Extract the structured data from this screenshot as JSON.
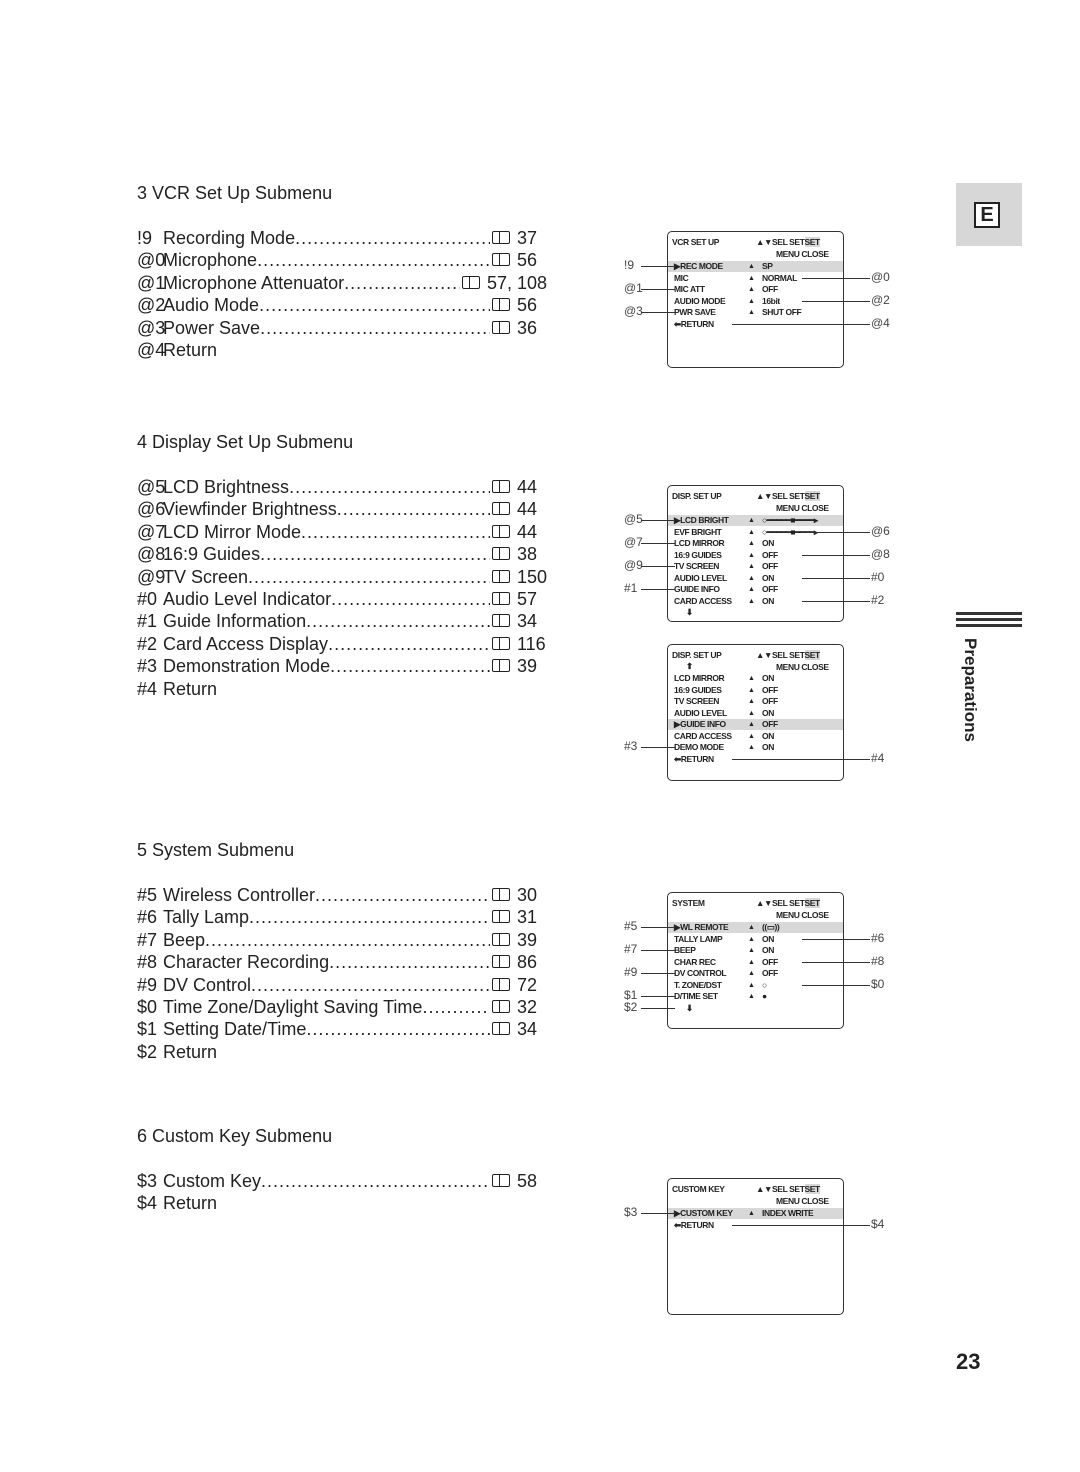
{
  "sections": [
    {
      "title": "3  VCR Set Up Submenu",
      "items": [
        {
          "code": "!9",
          "label": "Recording Mode",
          "page": "37"
        },
        {
          "code": "@0",
          "label": "Microphone",
          "page": "56"
        },
        {
          "code": "@1",
          "label": "Microphone Attenuator",
          "page": "57, 108"
        },
        {
          "code": "@2",
          "label": "Audio Mode",
          "page": "56"
        },
        {
          "code": "@3",
          "label": "Power Save",
          "page": "36"
        },
        {
          "code": "@4",
          "label": "Return",
          "page": ""
        }
      ]
    },
    {
      "title": "4  Display Set Up Submenu",
      "items": [
        {
          "code": "@5",
          "label": "LCD Brightness",
          "page": "44"
        },
        {
          "code": "@6",
          "label": "Viewfinder Brightness",
          "page": "44"
        },
        {
          "code": "@7",
          "label": "LCD Mirror Mode",
          "page": "44"
        },
        {
          "code": "@8",
          "label": "16:9 Guides",
          "page": "38"
        },
        {
          "code": "@9",
          "label": "TV Screen",
          "page": "150"
        },
        {
          "code": "#0",
          "label": "Audio Level Indicator",
          "page": "57"
        },
        {
          "code": "#1",
          "label": "Guide Information",
          "page": "34"
        },
        {
          "code": "#2",
          "label": "Card Access Display",
          "page": "116"
        },
        {
          "code": "#3",
          "label": "Demonstration Mode",
          "page": "39"
        },
        {
          "code": "#4",
          "label": "Return",
          "page": ""
        }
      ]
    },
    {
      "title": "5  System Submenu",
      "items": [
        {
          "code": "#5",
          "label": "Wireless Controller",
          "page": "30"
        },
        {
          "code": "#6",
          "label": "Tally Lamp",
          "page": "31"
        },
        {
          "code": "#7",
          "label": "Beep",
          "page": "39"
        },
        {
          "code": "#8",
          "label": "Character Recording",
          "page": "86"
        },
        {
          "code": "#9",
          "label": "DV Control",
          "page": "72"
        },
        {
          "code": "$0",
          "label": "Time Zone/Daylight Saving Time",
          "page": "32"
        },
        {
          "code": "$1",
          "label": "Setting Date/Time",
          "page": "34"
        },
        {
          "code": "$2",
          "label": "Return",
          "page": ""
        }
      ]
    },
    {
      "title": "6  Custom Key Submenu",
      "items": [
        {
          "code": "$3",
          "label": "Custom Key",
          "page": "58"
        },
        {
          "code": "$4",
          "label": "Return",
          "page": ""
        }
      ]
    }
  ],
  "screens": [
    {
      "title": "VCR SET UP",
      "sel": "▲▼SEL SET",
      "set": "SET",
      "close": "MENU CLOSE",
      "top_arrow": "",
      "bottom_arrow": "",
      "rows": [
        {
          "label": "▶REC MODE",
          "mark": "▲",
          "value": "SP",
          "hl": true,
          "left": "!9"
        },
        {
          "label": "MIC",
          "mark": "▲",
          "value": "NORMAL",
          "right": "@0"
        },
        {
          "label": "MIC ATT",
          "mark": "▲",
          "value": "OFF",
          "left": "@1"
        },
        {
          "label": "AUDIO MODE",
          "mark": "▲",
          "value": "16bit",
          "right": "@2"
        },
        {
          "label": "PWR SAVE",
          "mark": "▲",
          "value": "SHUT OFF",
          "left": "@3"
        },
        {
          "label": "⬅RETURN",
          "mark": "",
          "value": "",
          "right": "@4"
        }
      ]
    },
    {
      "title": "DISP. SET UP",
      "sel": "▲▼SEL SET",
      "set": "SET",
      "close": "MENU CLOSE",
      "top_arrow": "",
      "bottom_arrow": "⬇",
      "rows": [
        {
          "label": "▶LCD BRIGHT",
          "mark": "▲",
          "value": "○━━━━━■━━━━▸",
          "hl": true,
          "left": "@5"
        },
        {
          "label": "EVF BRIGHT",
          "mark": "▲",
          "value": "○━━━━━■━━━━▸",
          "right": "@6"
        },
        {
          "label": "LCD MIRROR",
          "mark": "▲",
          "value": "ON",
          "left": "@7"
        },
        {
          "label": "16:9 GUIDES",
          "mark": "▲",
          "value": "OFF",
          "right": "@8"
        },
        {
          "label": "TV SCREEN",
          "mark": "▲",
          "value": "OFF",
          "left": "@9"
        },
        {
          "label": "AUDIO LEVEL",
          "mark": "▲",
          "value": "ON",
          "right": "#0"
        },
        {
          "label": "GUIDE INFO",
          "mark": "▲",
          "value": "OFF",
          "left": "#1"
        },
        {
          "label": "CARD ACCESS",
          "mark": "▲",
          "value": "ON",
          "right": "#2"
        }
      ]
    },
    {
      "title": "DISP. SET UP",
      "sel": "▲▼SEL SET",
      "set": "SET",
      "close": "MENU CLOSE",
      "top_arrow": "⬆",
      "bottom_arrow": "",
      "rows": [
        {
          "label": "LCD MIRROR",
          "mark": "▲",
          "value": "ON"
        },
        {
          "label": "16:9 GUIDES",
          "mark": "▲",
          "value": "OFF"
        },
        {
          "label": "TV SCREEN",
          "mark": "▲",
          "value": "OFF"
        },
        {
          "label": "AUDIO LEVEL",
          "mark": "▲",
          "value": "ON"
        },
        {
          "label": "▶GUIDE INFO",
          "mark": "▲",
          "value": "OFF",
          "hl": true
        },
        {
          "label": "CARD ACCESS",
          "mark": "▲",
          "value": "ON"
        },
        {
          "label": "DEMO MODE",
          "mark": "▲",
          "value": "ON",
          "left": "#3"
        },
        {
          "label": "⬅RETURN",
          "mark": "",
          "value": "",
          "right": "#4"
        }
      ]
    },
    {
      "title": "SYSTEM",
      "sel": "▲▼SEL SET",
      "set": "SET",
      "close": "MENU CLOSE",
      "top_arrow": "",
      "bottom_arrow": "⬇",
      "bottom_left": "$2",
      "rows": [
        {
          "label": "▶WL REMOTE",
          "mark": "▲",
          "value": "((▭))",
          "hl": true,
          "left": "#5"
        },
        {
          "label": "TALLY LAMP",
          "mark": "▲",
          "value": "ON",
          "right": "#6"
        },
        {
          "label": "BEEP",
          "mark": "▲",
          "value": "ON",
          "left": "#7"
        },
        {
          "label": "CHAR REC",
          "mark": "▲",
          "value": "OFF",
          "right": "#8"
        },
        {
          "label": "DV CONTROL",
          "mark": "▲",
          "value": "OFF",
          "left": "#9"
        },
        {
          "label": "T. ZONE/DST",
          "mark": "▲",
          "value": "○",
          "right": "$0"
        },
        {
          "label": "D/TIME SET",
          "mark": "▲",
          "value": "●",
          "left": "$1"
        }
      ]
    },
    {
      "title": "CUSTOM KEY",
      "sel": "▲▼SEL SET",
      "set": "SET",
      "close": "MENU CLOSE",
      "top_arrow": "",
      "bottom_arrow": "",
      "rows": [
        {
          "label": "▶CUSTOM KEY",
          "mark": "▲",
          "value": "INDEX WRITE",
          "hl": true,
          "left": "$3"
        },
        {
          "label": "⬅RETURN",
          "mark": "",
          "value": "",
          "right": "$4"
        }
      ]
    }
  ],
  "side_tab": "E",
  "side_label": "Preparations",
  "page_number": "23"
}
